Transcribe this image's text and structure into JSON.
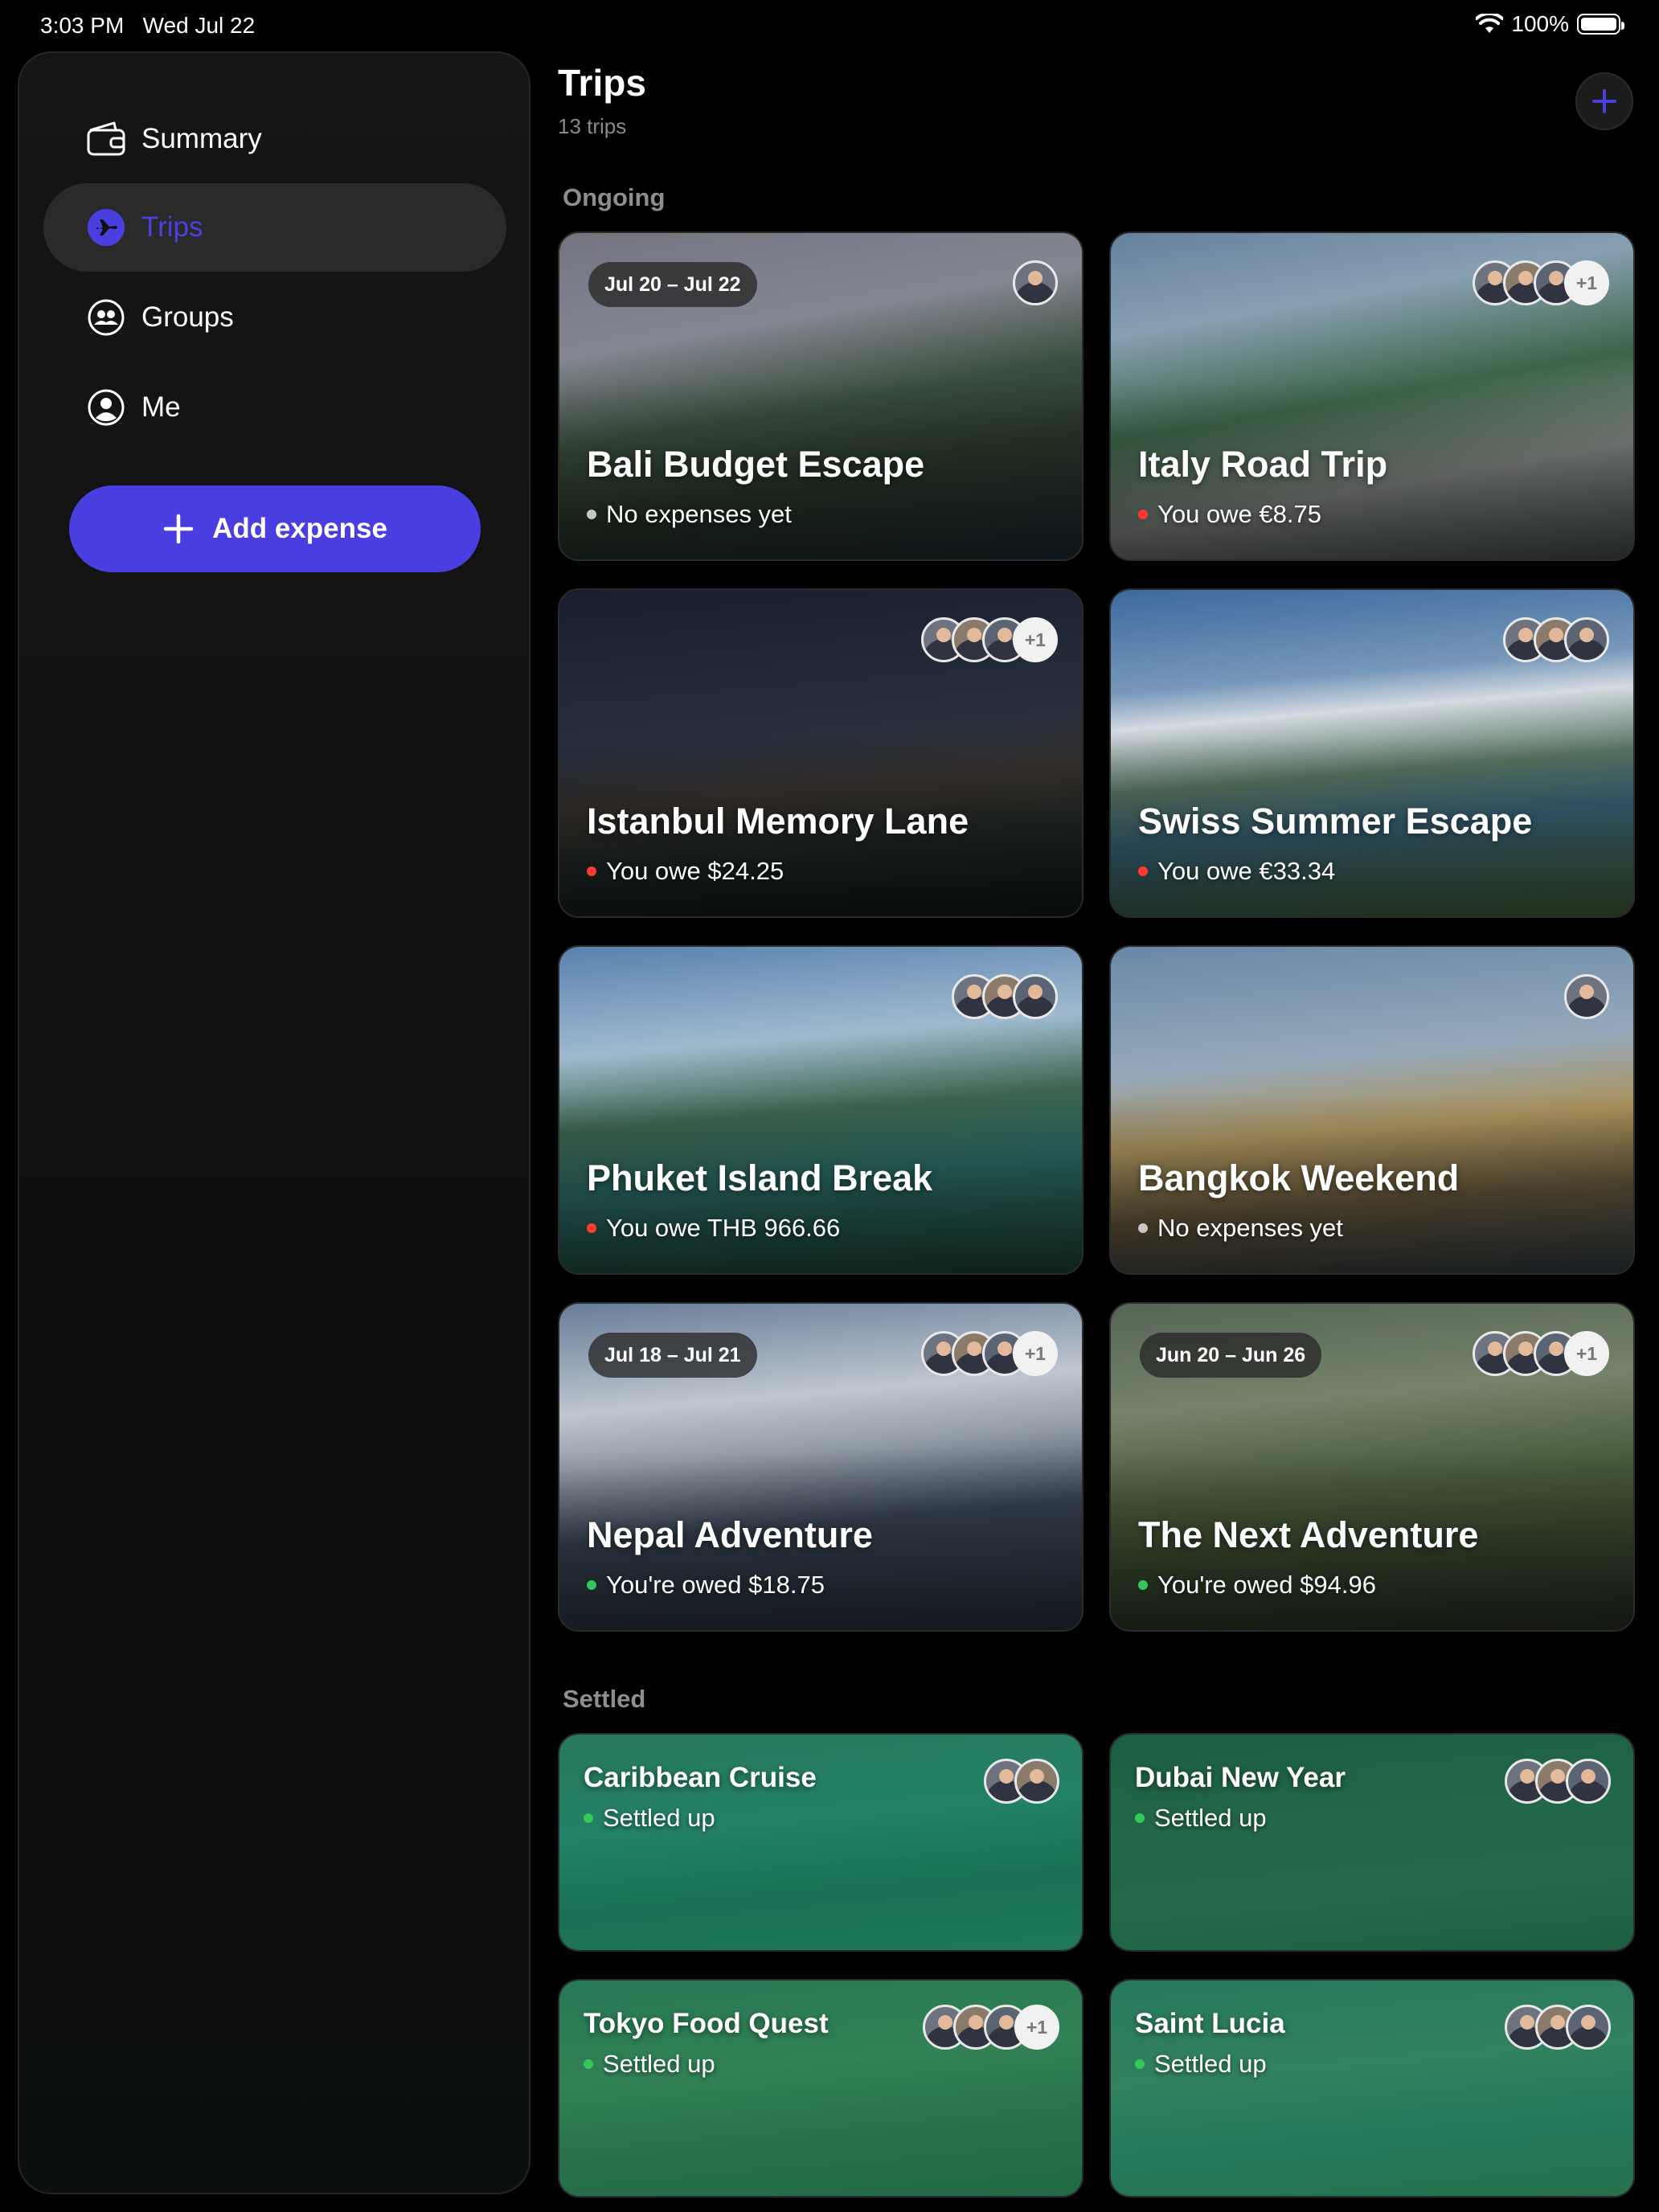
{
  "status_bar": {
    "time": "3:03 PM",
    "date": "Wed Jul 22",
    "battery": "100%"
  },
  "sidebar": {
    "items": [
      {
        "label": "Summary",
        "icon": "wallet-icon"
      },
      {
        "label": "Trips",
        "icon": "airplane-icon",
        "active": true
      },
      {
        "label": "Groups",
        "icon": "groups-icon"
      },
      {
        "label": "Me",
        "icon": "person-icon"
      }
    ],
    "add_expense_label": "Add expense"
  },
  "header": {
    "title": "Trips",
    "count": "13 trips"
  },
  "sections": {
    "ongoing": "Ongoing",
    "settled": "Settled"
  },
  "colors": {
    "accent": "#4a3ee0",
    "owe": "#ff3b30",
    "owed": "#34c759",
    "none": "#c7c7c7"
  },
  "ongoing_trips": [
    {
      "title": "Bali Budget Escape",
      "status": "No expenses yet",
      "status_kind": "none",
      "dates": "Jul 20 – Jul 22",
      "members": 1,
      "extra": ""
    },
    {
      "title": "Italy Road Trip",
      "status": "You owe €8.75",
      "status_kind": "owe",
      "dates": "",
      "members": 3,
      "extra": "+1"
    },
    {
      "title": "Istanbul Memory Lane",
      "status": "You owe $24.25",
      "status_kind": "owe",
      "dates": "",
      "members": 3,
      "extra": "+1"
    },
    {
      "title": "Swiss Summer Escape",
      "status": "You owe €33.34",
      "status_kind": "owe",
      "dates": "",
      "members": 3,
      "extra": ""
    },
    {
      "title": "Phuket Island Break",
      "status": "You owe THB 966.66",
      "status_kind": "owe",
      "dates": "",
      "members": 3,
      "extra": ""
    },
    {
      "title": "Bangkok Weekend",
      "status": "No expenses yet",
      "status_kind": "none",
      "dates": "",
      "members": 1,
      "extra": ""
    },
    {
      "title": "Nepal Adventure",
      "status": "You're owed $18.75",
      "status_kind": "owed",
      "dates": "Jul 18 – Jul 21",
      "members": 3,
      "extra": "+1"
    },
    {
      "title": "The Next Adventure",
      "status": "You're owed $94.96",
      "status_kind": "owed",
      "dates": "Jun 20 – Jun 26",
      "members": 3,
      "extra": "+1"
    }
  ],
  "settled_trips": [
    {
      "title": "Caribbean Cruise",
      "status": "Settled up",
      "members": 2,
      "extra": ""
    },
    {
      "title": "Dubai New Year",
      "status": "Settled up",
      "members": 3,
      "extra": ""
    },
    {
      "title": "Tokyo Food Quest",
      "status": "Settled up",
      "members": 3,
      "extra": "+1"
    },
    {
      "title": "Saint Lucia",
      "status": "Settled up",
      "members": 3,
      "extra": ""
    }
  ]
}
